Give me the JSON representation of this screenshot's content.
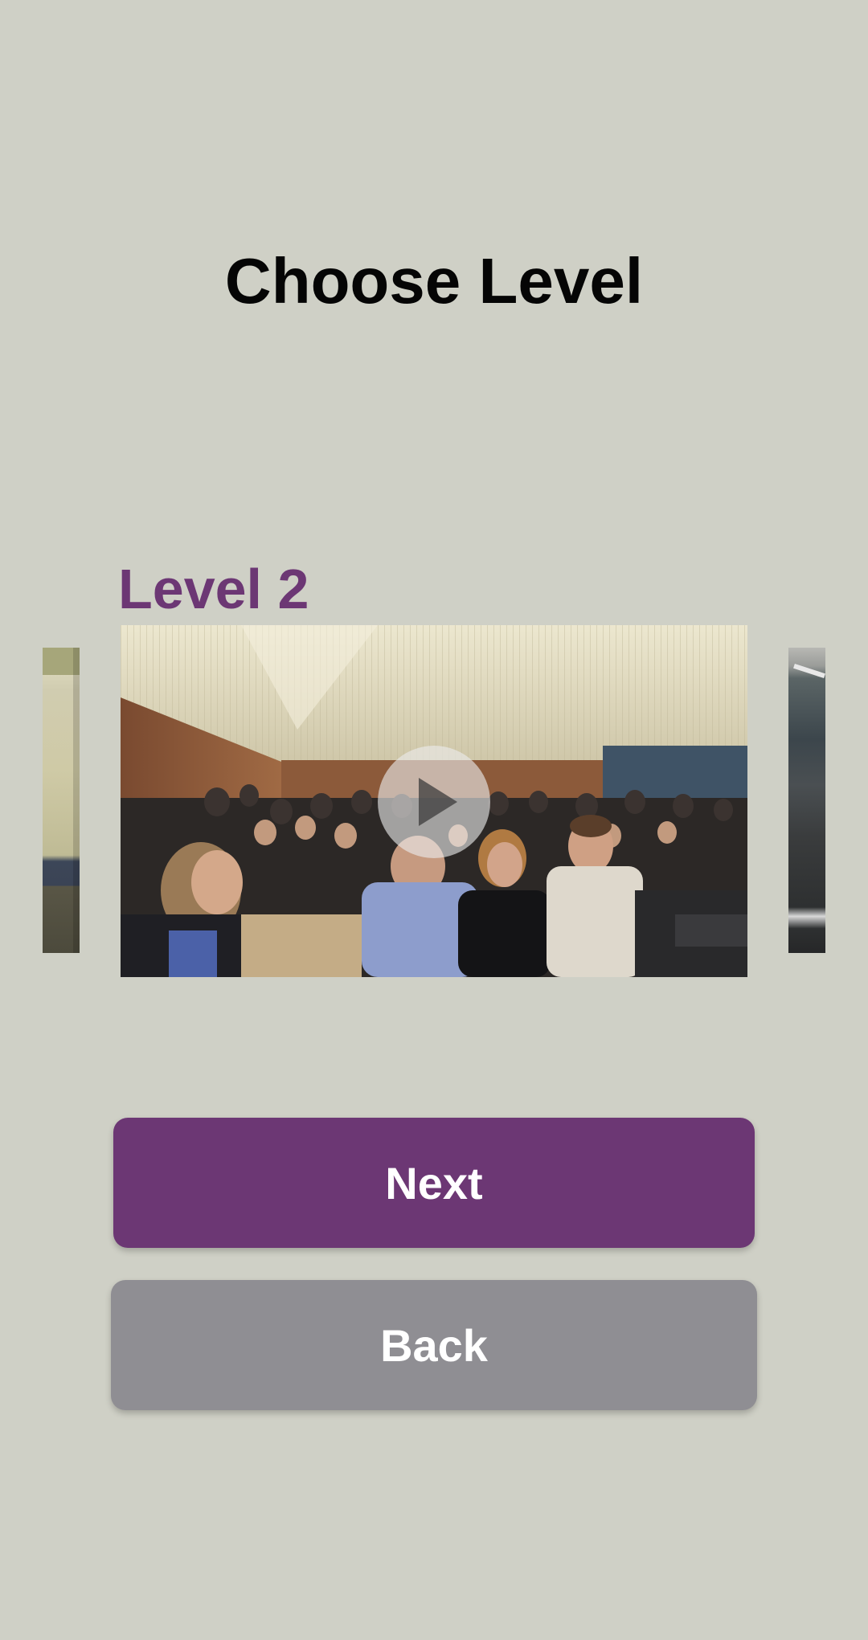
{
  "header": {
    "title": "Choose Level"
  },
  "carousel": {
    "current_level_label": "Level 2",
    "main_video": {
      "icon": "play-icon"
    }
  },
  "actions": {
    "next_label": "Next",
    "back_label": "Back"
  },
  "colors": {
    "background": "#cfd0c6",
    "accent": "#6c3774",
    "back_button": "#8f8e93",
    "title": "#050505"
  }
}
